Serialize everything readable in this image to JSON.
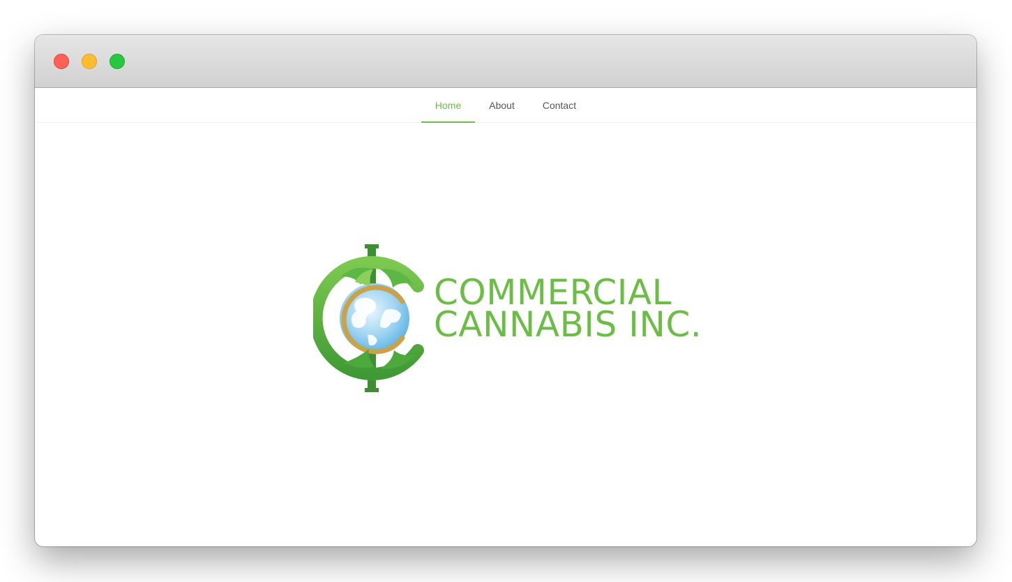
{
  "window": {
    "controls": [
      "close",
      "minimize",
      "maximize"
    ],
    "colors": {
      "close": "#fe5f57",
      "minimize": "#febc2e",
      "maximize": "#28c840"
    }
  },
  "nav": {
    "items": [
      {
        "label": "Home",
        "active": true
      },
      {
        "label": "About",
        "active": false
      },
      {
        "label": "Contact",
        "active": false
      }
    ],
    "accent_color": "#6cbd45"
  },
  "logo": {
    "line1": "COMMERCIAL",
    "line2": "CANNABIS INC.",
    "icon": "globe-leaf-logo-icon",
    "brand_green": "#6cbd45",
    "gold": "#c9a24a"
  }
}
